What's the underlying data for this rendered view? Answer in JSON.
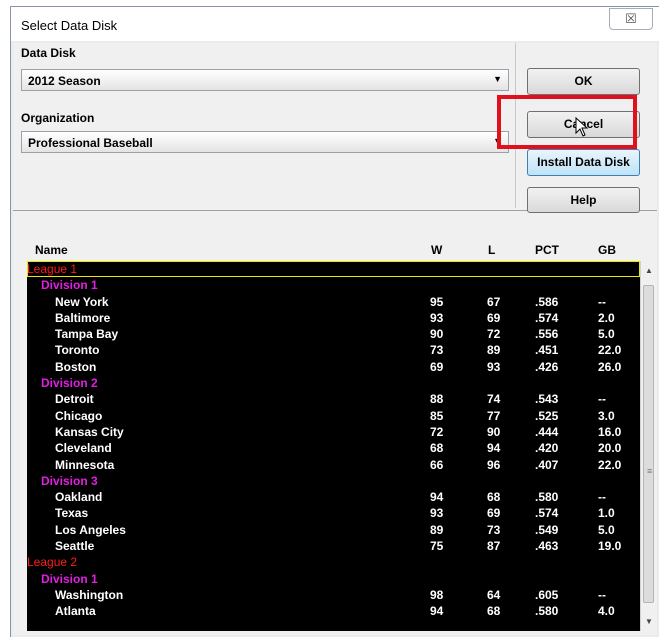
{
  "window": {
    "title": "Select Data Disk",
    "close_glyph": "☒"
  },
  "data_disk": {
    "label": "Data Disk",
    "value": "2012  Season"
  },
  "organization": {
    "label": "Organization",
    "value": "Professional Baseball"
  },
  "buttons": {
    "ok": "OK",
    "cancel": "Cancel",
    "install": "Install Data Disk",
    "help": "Help"
  },
  "columns": {
    "name": "Name",
    "w": "W",
    "l": "L",
    "pct": "PCT",
    "gb": "GB"
  },
  "colors": {
    "league": "#ff1a1a",
    "division": "#e020e0",
    "team": "#ffffff",
    "highlight_box": "#e0101c"
  },
  "rows": [
    {
      "type": "league",
      "name": "League 1",
      "selected": true
    },
    {
      "type": "division",
      "name": "Division 1"
    },
    {
      "type": "team",
      "name": "New York",
      "w": "95",
      "l": "67",
      "pct": ".586",
      "gb": "--"
    },
    {
      "type": "team",
      "name": "Baltimore",
      "w": "93",
      "l": "69",
      "pct": ".574",
      "gb": "2.0"
    },
    {
      "type": "team",
      "name": "Tampa Bay",
      "w": "90",
      "l": "72",
      "pct": ".556",
      "gb": "5.0"
    },
    {
      "type": "team",
      "name": "Toronto",
      "w": "73",
      "l": "89",
      "pct": ".451",
      "gb": "22.0"
    },
    {
      "type": "team",
      "name": "Boston",
      "w": "69",
      "l": "93",
      "pct": ".426",
      "gb": "26.0"
    },
    {
      "type": "division",
      "name": "Division 2"
    },
    {
      "type": "team",
      "name": "Detroit",
      "w": "88",
      "l": "74",
      "pct": ".543",
      "gb": "--"
    },
    {
      "type": "team",
      "name": "Chicago",
      "w": "85",
      "l": "77",
      "pct": ".525",
      "gb": "3.0"
    },
    {
      "type": "team",
      "name": "Kansas City",
      "w": "72",
      "l": "90",
      "pct": ".444",
      "gb": "16.0"
    },
    {
      "type": "team",
      "name": "Cleveland",
      "w": "68",
      "l": "94",
      "pct": ".420",
      "gb": "20.0"
    },
    {
      "type": "team",
      "name": "Minnesota",
      "w": "66",
      "l": "96",
      "pct": ".407",
      "gb": "22.0"
    },
    {
      "type": "division",
      "name": "Division 3"
    },
    {
      "type": "team",
      "name": "Oakland",
      "w": "94",
      "l": "68",
      "pct": ".580",
      "gb": "--"
    },
    {
      "type": "team",
      "name": "Texas",
      "w": "93",
      "l": "69",
      "pct": ".574",
      "gb": "1.0"
    },
    {
      "type": "team",
      "name": "Los Angeles",
      "w": "89",
      "l": "73",
      "pct": ".549",
      "gb": "5.0"
    },
    {
      "type": "team",
      "name": "Seattle",
      "w": "75",
      "l": "87",
      "pct": ".463",
      "gb": "19.0"
    },
    {
      "type": "league",
      "name": "League 2"
    },
    {
      "type": "division",
      "name": "Division 1"
    },
    {
      "type": "team",
      "name": "Washington",
      "w": "98",
      "l": "64",
      "pct": ".605",
      "gb": "--"
    },
    {
      "type": "team",
      "name": "Atlanta",
      "w": "94",
      "l": "68",
      "pct": ".580",
      "gb": "4.0"
    }
  ]
}
